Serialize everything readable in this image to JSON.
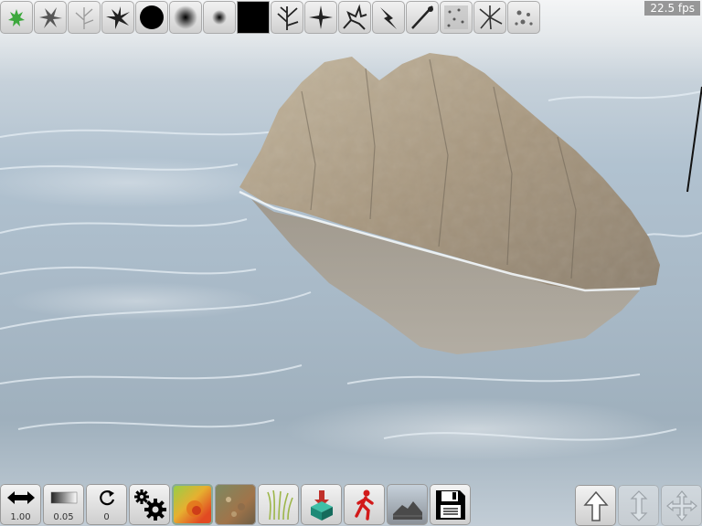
{
  "app": {
    "fps_text": "22.5 fps"
  },
  "brushes": [
    {
      "icon": "green-splat-brush-icon",
      "selected": true
    },
    {
      "icon": "splat-brush-icon"
    },
    {
      "icon": "faint-branch-brush-icon"
    },
    {
      "icon": "splash-brush-icon"
    },
    {
      "icon": "hard-circle-brush-icon"
    },
    {
      "icon": "soft-circle-brush-icon"
    },
    {
      "icon": "small-circle-brush-icon"
    },
    {
      "icon": "solid-black-brush-icon"
    },
    {
      "icon": "branch-brush-icon"
    },
    {
      "icon": "star-brush-icon"
    },
    {
      "icon": "crack-brush-icon"
    },
    {
      "icon": "lightning-brush-icon"
    },
    {
      "icon": "streak-brush-icon"
    },
    {
      "icon": "noise-brush-icon"
    },
    {
      "icon": "burst-brush-icon"
    },
    {
      "icon": "dots-brush-icon"
    }
  ],
  "controls": {
    "brush_size": {
      "icon": "double-arrow-icon",
      "value": "1.00"
    },
    "brush_strength": {
      "icon": "gradient-icon",
      "value": "0.05"
    },
    "brush_rotation": {
      "icon": "rotate-icon",
      "value": "0"
    }
  },
  "buttons": [
    {
      "name": "settings-button",
      "icon": "gears-icon"
    },
    {
      "name": "heightmap-paint-button",
      "icon": "heightmap-icon"
    },
    {
      "name": "texture-paint-button",
      "icon": "rock-texture-icon"
    },
    {
      "name": "grass-paint-button",
      "icon": "grass-icon"
    },
    {
      "name": "import-button",
      "icon": "box-arrow-down-icon"
    },
    {
      "name": "walk-mode-button",
      "icon": "walking-man-icon"
    },
    {
      "name": "terrain-view-button",
      "icon": "terrain-icon"
    },
    {
      "name": "save-button",
      "icon": "floppy-disk-icon"
    }
  ],
  "nav_buttons": [
    {
      "name": "move-up-button",
      "icon": "arrow-up-icon"
    },
    {
      "name": "move-vertical-button",
      "icon": "up-down-arrows-icon",
      "enabled": false
    },
    {
      "name": "move-all-button",
      "icon": "four-arrows-icon",
      "enabled": false
    }
  ],
  "colors": {
    "water": "#a9bac8",
    "rock": "#b4a48c",
    "sky": "#f4f5f6",
    "button_bg": "#dedede"
  }
}
